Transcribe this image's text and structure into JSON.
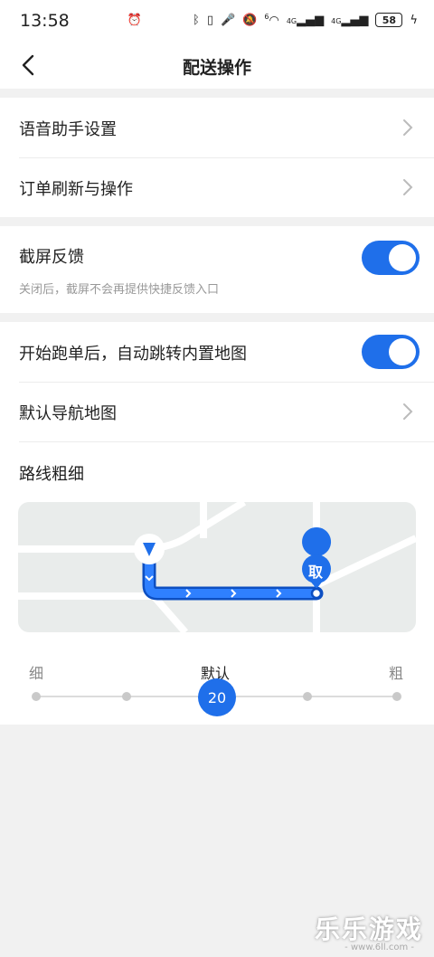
{
  "status_bar": {
    "time": "13:58",
    "signal_a": "4G",
    "signal_b": "4G",
    "wifi_badge": "6",
    "battery": "58"
  },
  "header": {
    "title": "配送操作"
  },
  "settings": {
    "voice_assistant": "语音助手设置",
    "order_refresh": "订单刷新与操作",
    "screenshot_feedback": "截屏反馈",
    "screenshot_feedback_desc": "关闭后，截屏不会再提供快捷反馈入口",
    "screenshot_feedback_on": true,
    "auto_jump_map": "开始跑单后，自动跳转内置地图",
    "auto_jump_map_on": true,
    "default_nav_map": "默认导航地图",
    "route_width": "路线粗细"
  },
  "map_preview": {
    "pickup_label": "取"
  },
  "route_slider": {
    "min_label": "细",
    "default_label": "默认",
    "max_label": "粗",
    "value": "20",
    "steps": 5,
    "selected_step": 2
  },
  "watermark": {
    "brand": "乐乐游戏",
    "site": "- www.6ll.com -"
  },
  "colors": {
    "accent": "#1f6fea",
    "background": "#f1f1f1"
  }
}
